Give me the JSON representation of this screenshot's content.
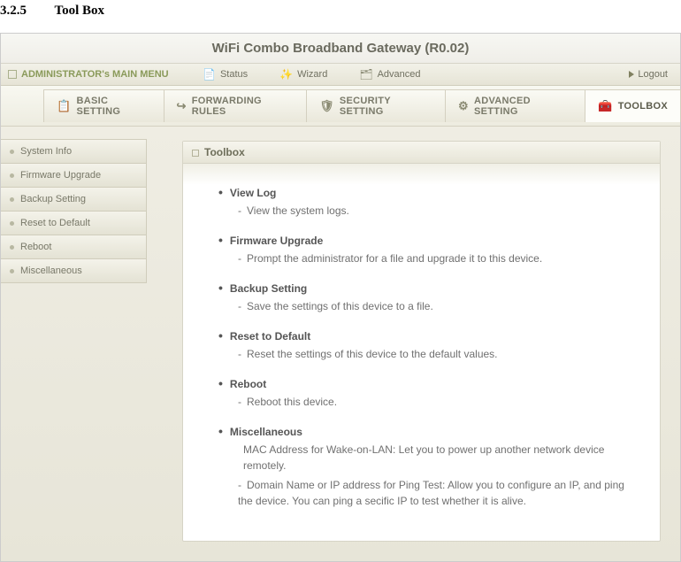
{
  "doc": {
    "section_num": "3.2.5",
    "section_title": "Tool Box"
  },
  "header": {
    "title": "WiFi Combo Broadband Gateway (R0.02)"
  },
  "menubar": {
    "admin": "ADMINISTRATOR's MAIN MENU",
    "status": "Status",
    "wizard": "Wizard",
    "advanced": "Advanced",
    "logout": "Logout"
  },
  "tabs": {
    "basic": "BASIC SETTING",
    "forwarding": "FORWARDING RULES",
    "security": "SECURITY SETTING",
    "advanced": "ADVANCED SETTING",
    "toolbox": "TOOLBOX"
  },
  "sidebar": {
    "items": [
      {
        "label": "System Info"
      },
      {
        "label": "Firmware Upgrade"
      },
      {
        "label": "Backup Setting"
      },
      {
        "label": "Reset to Default"
      },
      {
        "label": "Reboot"
      },
      {
        "label": "Miscellaneous"
      }
    ]
  },
  "panel": {
    "title": "Toolbox",
    "items": [
      {
        "title": "View Log",
        "lines": [
          {
            "text": "View the system logs.",
            "dash": true
          }
        ]
      },
      {
        "title": "Firmware Upgrade",
        "lines": [
          {
            "text": "Prompt the administrator for a file and upgrade it to this device.",
            "dash": true
          }
        ]
      },
      {
        "title": "Backup Setting",
        "lines": [
          {
            "text": "Save the settings of this device to a file.",
            "dash": true
          }
        ]
      },
      {
        "title": "Reset to Default",
        "lines": [
          {
            "text": "Reset the settings of this device to the default values.",
            "dash": true
          }
        ]
      },
      {
        "title": "Reboot",
        "lines": [
          {
            "text": "Reboot this device.",
            "dash": true
          }
        ]
      },
      {
        "title": "Miscellaneous",
        "lines": [
          {
            "text": "MAC Address for Wake-on-LAN: Let you to power up another network device remotely.",
            "dash": false
          },
          {
            "text": "Domain Name or IP address for Ping Test: Allow you to configure an IP, and ping the device. You can ping a secific IP to test whether it is alive.",
            "dash": true
          }
        ]
      }
    ]
  }
}
